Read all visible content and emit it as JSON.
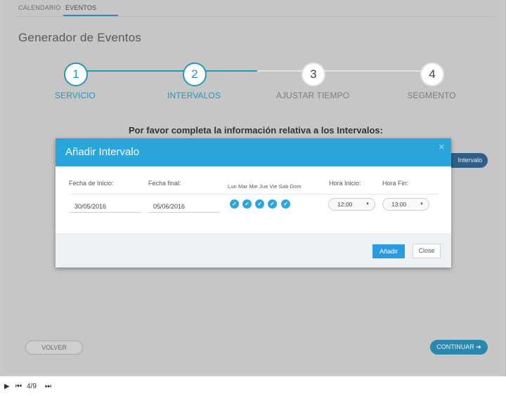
{
  "topnav": {
    "tabs": [
      {
        "label": "CALENDARIO"
      },
      {
        "label": "EVENTOS"
      }
    ]
  },
  "page": {
    "title": "Generador de Eventos"
  },
  "stepper": {
    "steps": [
      {
        "number": "1",
        "label": "SERVICIO",
        "state": "active"
      },
      {
        "number": "2",
        "label": "INTERVALOS",
        "state": "active"
      },
      {
        "number": "3",
        "label": "AJUSTAR TIEMPO",
        "state": "inactive"
      },
      {
        "number": "4",
        "label": "SEGMENTO",
        "state": "inactive"
      }
    ]
  },
  "instruction": "Por favor completa la información relativa a los Intervalos:",
  "background_button": {
    "label": "Intervalo"
  },
  "footer": {
    "back_label": "VOLVER",
    "continue_label": "CONTINUAR ➔"
  },
  "modal": {
    "title": "Añadir Intervalo",
    "close_icon": "close-icon",
    "labels": {
      "start_date": "Fecha de Inicio:",
      "end_date": "Fecha final:",
      "days": "Lun Mar Mie Jue Vie Sab Dom",
      "start_time": "Hora Inicio:",
      "end_time": "Hora Fin:"
    },
    "values": {
      "start_date": "30/05/2016",
      "end_date": "05/06/2016",
      "start_time": "12:00",
      "end_time": "13:00"
    },
    "day_checks": [
      {
        "checked": true
      },
      {
        "checked": true
      },
      {
        "checked": true
      },
      {
        "checked": true
      },
      {
        "checked": true
      }
    ],
    "add_label": "Añadir",
    "close_label": "Close"
  },
  "player": {
    "play_icon": "▶",
    "rewind_icon": "⏮",
    "page_indicator": "4/9",
    "forward_icon": "⏭"
  },
  "colors": {
    "accent": "#2aa6dd",
    "stepper_active": "#2499b8",
    "continue_button": "#2a87ad"
  }
}
